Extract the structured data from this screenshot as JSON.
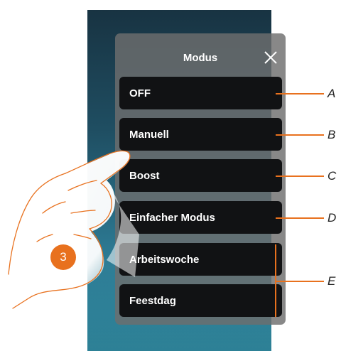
{
  "dialog": {
    "title": "Modus",
    "modes": [
      {
        "label": "OFF",
        "callout": "A"
      },
      {
        "label": "Manuell",
        "callout": "B"
      },
      {
        "label": "Boost",
        "callout": "C"
      },
      {
        "label": "Einfacher Modus",
        "callout": "D"
      },
      {
        "label": "Arbeitswoche"
      },
      {
        "label": "Feestdag"
      }
    ],
    "group_callout": "E"
  },
  "step": "3",
  "icons": {
    "close": "close-icon",
    "hand": "pointing-hand-icon"
  },
  "colors": {
    "accent": "#e8711e",
    "button": "#111214",
    "panel": "#6e6e6e",
    "screen": "#2c7891"
  }
}
